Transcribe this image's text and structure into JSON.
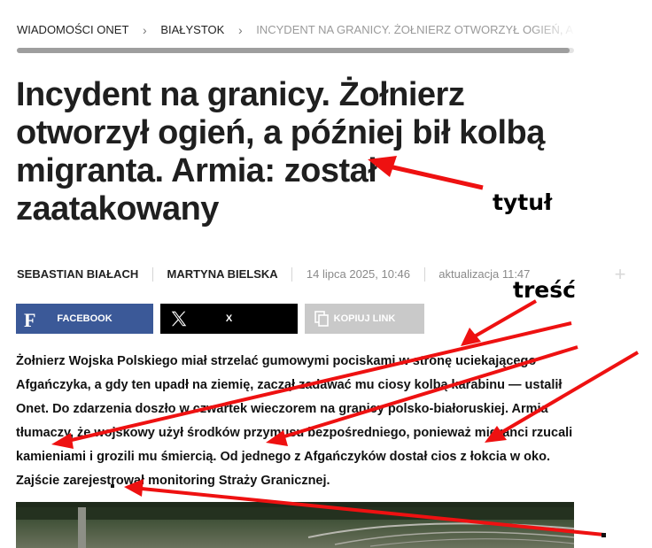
{
  "breadcrumbs": {
    "items": [
      "WIADOMOŚCI ONET",
      "BIAŁYSTOK",
      "INCYDENT NA GRANICY. ŻOŁNIERZ OTWORZYŁ OGIEŃ, A PÓŹNIEJ"
    ]
  },
  "article": {
    "title": "Incydent na granicy. Żołnierz otworzył ogień, a później bił kolbą migranta. Armia: został zaatakowany",
    "authors": [
      "SEBASTIAN BIAŁACH",
      "MARTYNA BIELSKA"
    ],
    "date": "14 lipca 2025, 10:46",
    "updated": "aktualizacja 11:47",
    "lead": "Żołnierz Wojska Polskiego miał strzelać gumowymi pociskami w stronę uciekającego Afgańczyka, a gdy ten upadł na ziemię, zaczął zadawać mu ciosy kolbą karabinu — ustalił Onet. Do zdarzenia doszło w czwartek wieczorem na granicy polsko-białoruskiej. Armia tłumaczy, że wojskowy użył środków przymusu bezpośredniego, ponieważ migranci rzucali kamieniami i grozili mu śmiercią. Od jednego z Afgańczyków dostał cios z łokcia w oko. Zajście zarejestrował monitoring Straży Granicznej."
  },
  "share": {
    "facebook": "FACEBOOK",
    "x": "X",
    "copy": "KOPIUJ LINK"
  },
  "annotations": {
    "title_label": "tytuł",
    "content_label": "treść",
    "arrow_color": "#ee1111"
  },
  "colors": {
    "facebook": "#3b5998",
    "x": "#000000",
    "copy": "#c9c9c9"
  }
}
